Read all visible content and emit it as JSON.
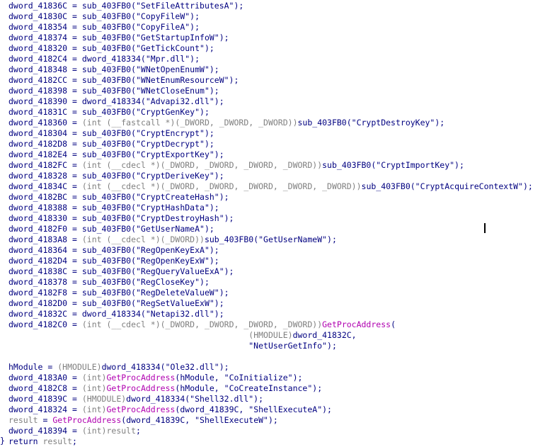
{
  "editor": {
    "closing_brace": "}",
    "lines": [
      [
        {
          "t": "dword_41836C = sub_403FB0(\"SetFileAttributesA\");",
          "c": "navy"
        }
      ],
      [
        {
          "t": "dword_41830C = sub_403FB0(\"CopyFileW\");",
          "c": "navy"
        }
      ],
      [
        {
          "t": "dword_418354 = sub_403FB0(\"CopyFileA\");",
          "c": "navy"
        }
      ],
      [
        {
          "t": "dword_418374 = sub_403FB0(\"GetStartupInfoW\");",
          "c": "navy"
        }
      ],
      [
        {
          "t": "dword_418320 = sub_403FB0(\"GetTickCount\");",
          "c": "navy"
        }
      ],
      [
        {
          "t": "dword_4182C4 = dword_418334(\"Mpr.dll\");",
          "c": "navy"
        }
      ],
      [
        {
          "t": "dword_418348 = sub_403FB0(\"WNetOpenEnumW\");",
          "c": "navy"
        }
      ],
      [
        {
          "t": "dword_4182CC = sub_403FB0(\"WNetEnumResourceW\");",
          "c": "navy"
        }
      ],
      [
        {
          "t": "dword_418398 = sub_403FB0(\"WNetCloseEnum\");",
          "c": "navy"
        }
      ],
      [
        {
          "t": "dword_418390 = dword_418334(\"Advapi32.dll\");",
          "c": "navy"
        }
      ],
      [
        {
          "t": "dword_41831C = sub_403FB0(\"CryptGenKey\");",
          "c": "navy"
        }
      ],
      [
        {
          "t": "dword_418360 = ",
          "c": "navy"
        },
        {
          "t": "(int (__fastcall *)(_DWORD, _DWORD, _DWORD))",
          "c": "gray"
        },
        {
          "t": "sub_403FB0(\"CryptDestroyKey\");",
          "c": "navy"
        }
      ],
      [
        {
          "t": "dword_418304 = sub_403FB0(\"CryptEncrypt\");",
          "c": "navy"
        }
      ],
      [
        {
          "t": "dword_4182D8 = sub_403FB0(\"CryptDecrypt\");",
          "c": "navy"
        }
      ],
      [
        {
          "t": "dword_4182E4 = sub_403FB0(\"CryptExportKey\");",
          "c": "navy"
        }
      ],
      [
        {
          "t": "dword_4182FC = ",
          "c": "navy"
        },
        {
          "t": "(int (__cdecl *)(_DWORD, _DWORD, _DWORD, _DWORD))",
          "c": "gray"
        },
        {
          "t": "sub_403FB0(\"CryptImportKey\");",
          "c": "navy"
        }
      ],
      [
        {
          "t": "dword_418328 = sub_403FB0(\"CryptDeriveKey\");",
          "c": "navy"
        }
      ],
      [
        {
          "t": "dword_41834C = ",
          "c": "navy"
        },
        {
          "t": "(int (__cdecl *)(_DWORD, _DWORD, _DWORD, _DWORD, _DWORD))",
          "c": "gray"
        },
        {
          "t": "sub_403FB0(\"CryptAcquireContextW\");",
          "c": "navy"
        }
      ],
      [
        {
          "t": "dword_4182BC = sub_403FB0(\"CryptCreateHash\");",
          "c": "navy"
        }
      ],
      [
        {
          "t": "dword_418388 = sub_403FB0(\"CryptHashData\");",
          "c": "navy"
        }
      ],
      [
        {
          "t": "dword_418330 = sub_403FB0(\"CryptDestroyHash\");",
          "c": "navy"
        }
      ],
      [
        {
          "t": "dword_4182F0 = sub_403FB0(\"GetUserNameA\");",
          "c": "navy"
        }
      ],
      [
        {
          "t": "dword_4183A8 = ",
          "c": "navy"
        },
        {
          "t": "(int (__cdecl *)(_DWORD))",
          "c": "gray"
        },
        {
          "t": "sub_403FB0(\"GetUserNameW\");",
          "c": "navy"
        }
      ],
      [
        {
          "t": "dword_418364 = sub_403FB0(\"RegOpenKeyExA\");",
          "c": "navy"
        }
      ],
      [
        {
          "t": "dword_4182D4 = sub_403FB0(\"RegOpenKeyExW\");",
          "c": "navy"
        }
      ],
      [
        {
          "t": "dword_41838C = sub_403FB0(\"RegQueryValueExA\");",
          "c": "navy"
        }
      ],
      [
        {
          "t": "dword_418378 = sub_403FB0(\"RegCloseKey\");",
          "c": "navy"
        }
      ],
      [
        {
          "t": "dword_4182F8 = sub_403FB0(\"RegDeleteValueW\");",
          "c": "navy"
        }
      ],
      [
        {
          "t": "dword_4182D0 = sub_403FB0(\"RegSetValueExW\");",
          "c": "navy"
        }
      ],
      [
        {
          "t": "dword_41832C = dword_418334(\"Netapi32.dll\");",
          "c": "navy"
        }
      ],
      [
        {
          "t": "dword_4182C0 = ",
          "c": "navy"
        },
        {
          "t": "(int (__cdecl *)(_DWORD, _DWORD, _DWORD, _DWORD))",
          "c": "gray"
        },
        {
          "t": "GetProcAddress",
          "c": "call"
        },
        {
          "t": "(",
          "c": "navy"
        }
      ],
      [
        {
          "t": "                                                 ",
          "c": "navy"
        },
        {
          "t": "(HMODULE)",
          "c": "gray"
        },
        {
          "t": "dword_41832C,",
          "c": "navy"
        }
      ],
      [
        {
          "t": "                                                 \"NetUserGetInfo\");",
          "c": "navy"
        }
      ],
      [],
      [
        {
          "t": "hModule = ",
          "c": "navy"
        },
        {
          "t": "(HMODULE)",
          "c": "gray"
        },
        {
          "t": "dword_418334(\"Ole32.dll\");",
          "c": "navy"
        }
      ],
      [
        {
          "t": "dword_4183A0 = ",
          "c": "navy"
        },
        {
          "t": "(int)",
          "c": "gray"
        },
        {
          "t": "GetProcAddress",
          "c": "call"
        },
        {
          "t": "(hModule, \"CoInitialize\");",
          "c": "navy"
        }
      ],
      [
        {
          "t": "dword_4182C8 = ",
          "c": "navy"
        },
        {
          "t": "(int)",
          "c": "gray"
        },
        {
          "t": "GetProcAddress",
          "c": "call"
        },
        {
          "t": "(hModule, \"CoCreateInstance\");",
          "c": "navy"
        }
      ],
      [
        {
          "t": "dword_41839C = ",
          "c": "navy"
        },
        {
          "t": "(HMODULE)",
          "c": "gray"
        },
        {
          "t": "dword_418334(\"Shell32.dll\");",
          "c": "navy"
        }
      ],
      [
        {
          "t": "dword_418324 = ",
          "c": "navy"
        },
        {
          "t": "(int)",
          "c": "gray"
        },
        {
          "t": "GetProcAddress",
          "c": "call"
        },
        {
          "t": "(dword_41839C, \"ShellExecuteA\");",
          "c": "navy"
        }
      ],
      [
        {
          "t": "result",
          "c": "local"
        },
        {
          "t": " = ",
          "c": "navy"
        },
        {
          "t": "GetProcAddress",
          "c": "call"
        },
        {
          "t": "(dword_41839C, \"ShellExecuteW\");",
          "c": "navy"
        }
      ],
      [
        {
          "t": "dword_418394 = ",
          "c": "navy"
        },
        {
          "t": "(int)",
          "c": "gray"
        },
        {
          "t": "result",
          "c": "local"
        },
        {
          "t": ";",
          "c": "navy"
        }
      ],
      [
        {
          "t": "return ",
          "c": "navy"
        },
        {
          "t": "result",
          "c": "local"
        },
        {
          "t": ";",
          "c": "navy"
        }
      ]
    ]
  }
}
